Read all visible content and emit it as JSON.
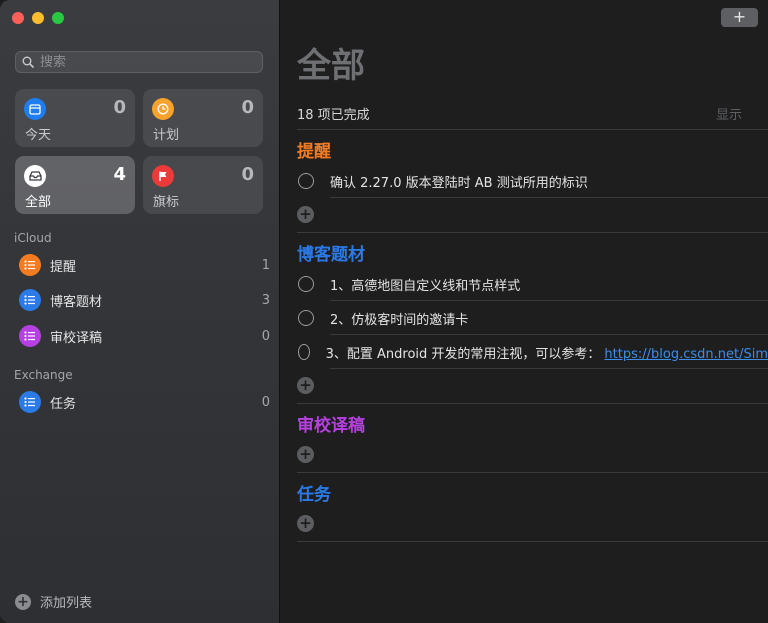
{
  "sidebar": {
    "search_placeholder": "搜索",
    "smart_lists": [
      {
        "label": "今天",
        "count": "0",
        "color": "#1e7ef0",
        "icon": "calendar-icon"
      },
      {
        "label": "计划",
        "count": "0",
        "color": "#f7a22b",
        "icon": "clock-icon"
      },
      {
        "label": "全部",
        "count": "4",
        "color": "#ffffff",
        "icon": "tray-icon"
      },
      {
        "label": "旗标",
        "count": "0",
        "color": "#ea3a3a",
        "icon": "flag-icon"
      }
    ],
    "accounts": [
      {
        "name": "iCloud",
        "lists": [
          {
            "label": "提醒",
            "count": "1",
            "color": "#f57b21"
          },
          {
            "label": "博客题材",
            "count": "3",
            "color": "#2a7ae8"
          },
          {
            "label": "审校译稿",
            "count": "0",
            "color": "#b541e0"
          }
        ]
      },
      {
        "name": "Exchange",
        "lists": [
          {
            "label": "任务",
            "count": "0",
            "color": "#2a7ae8"
          }
        ]
      }
    ],
    "add_list_label": "添加列表"
  },
  "main": {
    "add_button": "+",
    "title": "全部",
    "completed_count": "18 项已完成",
    "show_label": "显示",
    "groups": [
      {
        "title": "提醒",
        "color": "#f57b21",
        "tasks": [
          {
            "text": "确认 2.27.0 版本登陆时 AB 测试所用的标识"
          }
        ]
      },
      {
        "title": "博客题材",
        "color": "#2a7ae8",
        "tasks": [
          {
            "text": "1、高德地图自定义线和节点样式"
          },
          {
            "text": "2、仿极客时间的邀请卡"
          },
          {
            "text": "3、配置 Android 开发的常用注视，可以参考：",
            "link": "https://blog.csdn.net/Sim"
          }
        ]
      },
      {
        "title": "审校译稿",
        "color": "#b541e0",
        "tasks": []
      },
      {
        "title": "任务",
        "color": "#2a7ae8",
        "tasks": []
      }
    ]
  }
}
